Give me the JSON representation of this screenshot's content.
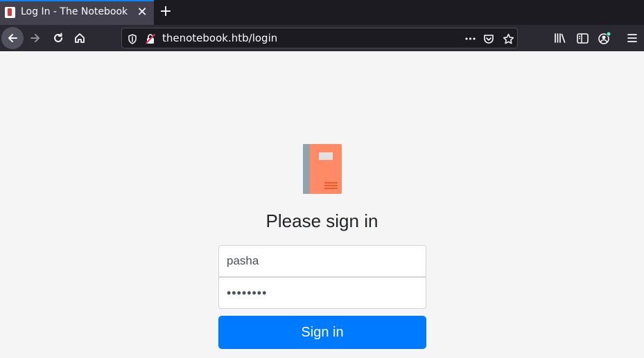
{
  "browser": {
    "tab": {
      "title": "Log In - The Notebook",
      "close": "✕"
    },
    "new_tab": "+",
    "url": "thenotebook.htb/login",
    "url_dots": "•••"
  },
  "page": {
    "heading": "Please sign in",
    "username_value": "pasha",
    "password_value": "••••••••",
    "signin_label": "Sign in"
  },
  "colors": {
    "accent": "#0a84ff",
    "button": "#007bff",
    "logo_cover": "#ff8a65",
    "logo_spine": "#90a4ae"
  }
}
